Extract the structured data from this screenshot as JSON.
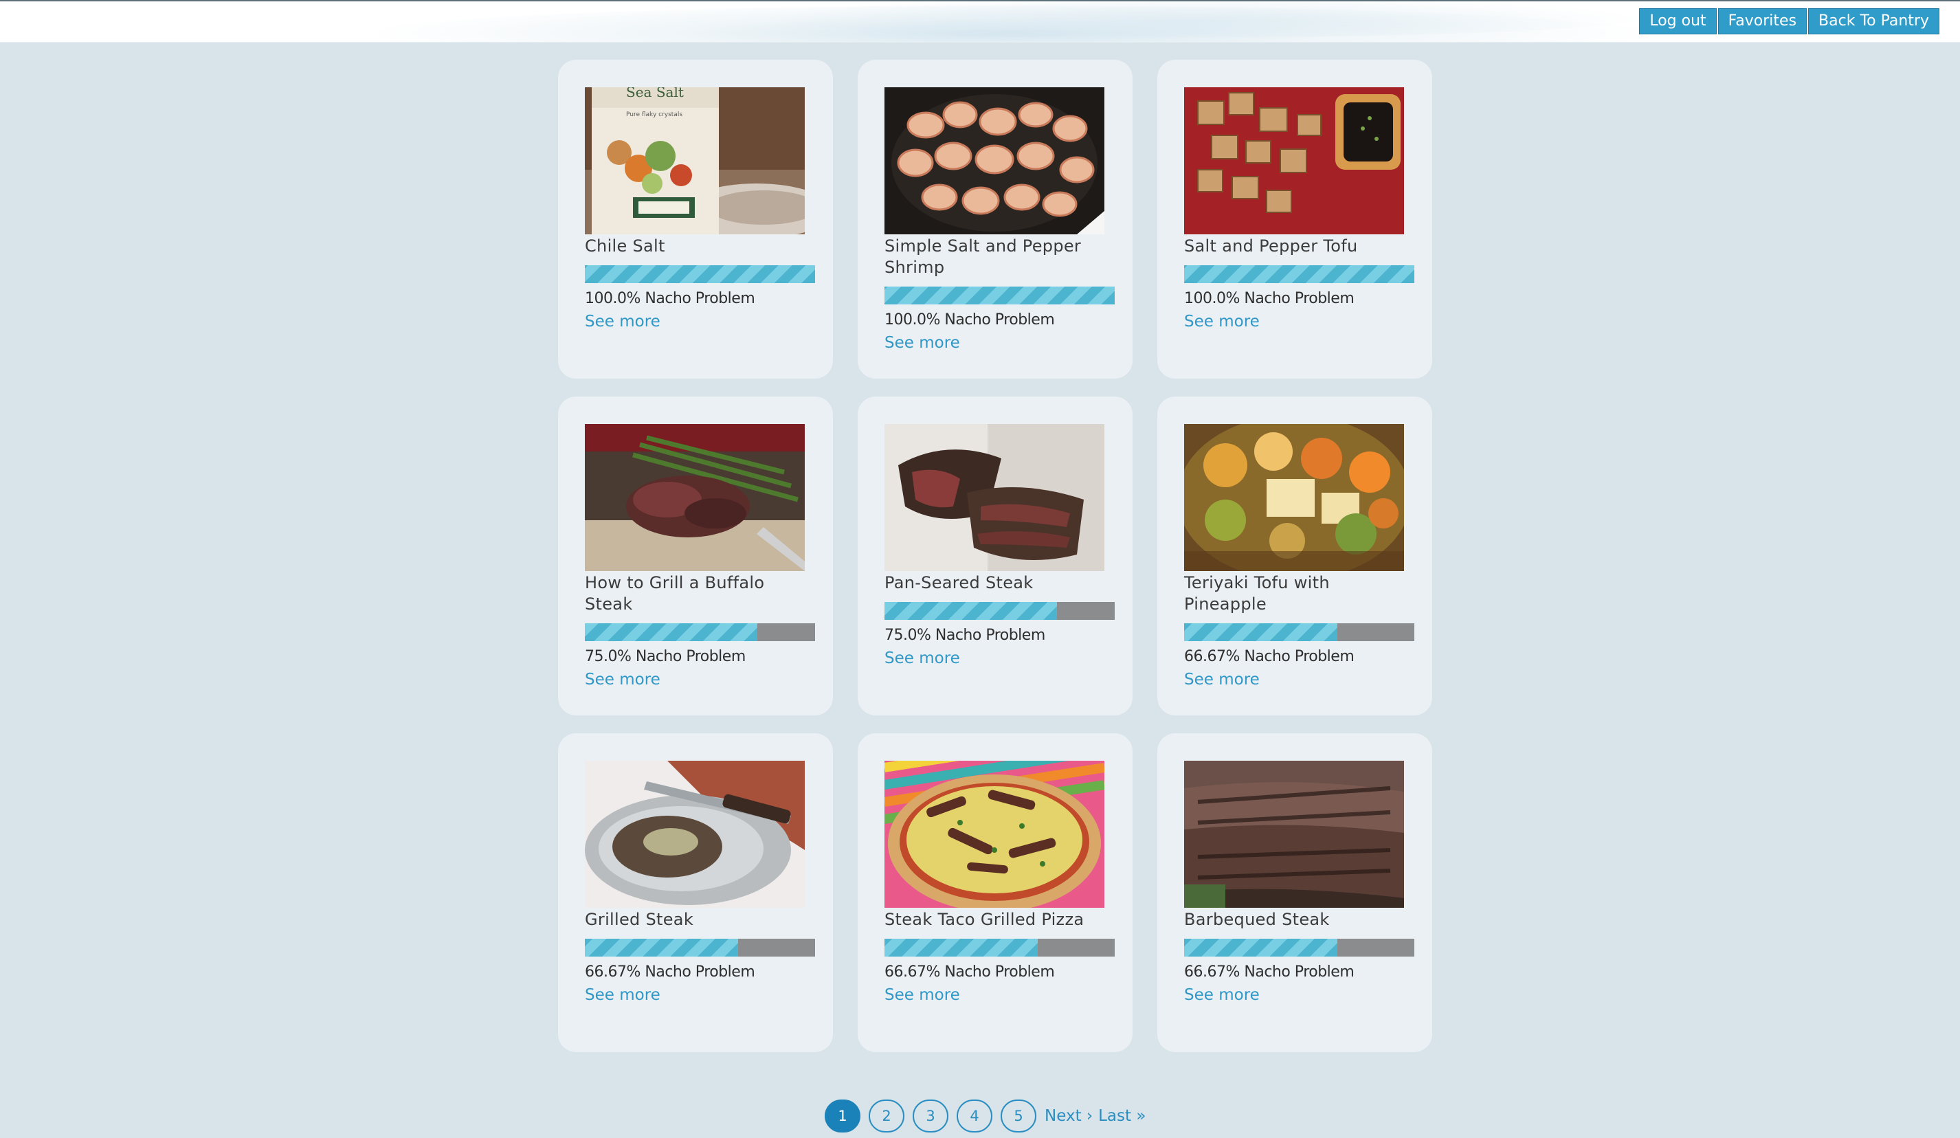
{
  "header": {
    "buttons": [
      "Log out",
      "Favorites",
      "Back To Pantry"
    ]
  },
  "colors": {
    "background": "#d8e3ea",
    "card": "#ebf0f4",
    "accent": "#2f9cc9",
    "bar_fill": "#4cb4cf",
    "bar_empty": "#8a8c8e"
  },
  "recipes": [
    {
      "title": "Chile Salt",
      "percent_text": "100.0% Nacho Problem",
      "percent": 100,
      "link": "See more",
      "image": "salt-box-photo"
    },
    {
      "title": "Simple Salt and Pepper Shrimp",
      "percent_text": "100.0% Nacho Problem",
      "percent": 100,
      "link": "See more",
      "image": "shrimp-photo"
    },
    {
      "title": "Salt and Pepper Tofu",
      "percent_text": "100.0% Nacho Problem",
      "percent": 100,
      "link": "See more",
      "image": "tofu-photo"
    },
    {
      "title": "How to Grill a Buffalo Steak",
      "percent_text": "75.0% Nacho Problem",
      "percent": 75,
      "link": "See more",
      "image": "buffalo-steak-photo"
    },
    {
      "title": "Pan-Seared Steak",
      "percent_text": "75.0% Nacho Problem",
      "percent": 75,
      "link": "See more",
      "image": "seared-steak-photo"
    },
    {
      "title": "Teriyaki Tofu with Pineapple",
      "percent_text": "66.67% Nacho Problem",
      "percent": 66.67,
      "link": "See more",
      "image": "teriyaki-tofu-photo"
    },
    {
      "title": "Grilled Steak",
      "percent_text": "66.67% Nacho Problem",
      "percent": 66.67,
      "link": "See more",
      "image": "grilled-steak-photo"
    },
    {
      "title": "Steak Taco Grilled Pizza",
      "percent_text": "66.67% Nacho Problem",
      "percent": 66.67,
      "link": "See more",
      "image": "pizza-photo"
    },
    {
      "title": "Barbequed Steak",
      "percent_text": "66.67% Nacho Problem",
      "percent": 66.67,
      "link": "See more",
      "image": "bbq-steak-photo"
    }
  ],
  "pagination": {
    "pages": [
      "1",
      "2",
      "3",
      "4",
      "5"
    ],
    "current": "1",
    "next": "Next ›",
    "last": "Last »"
  }
}
